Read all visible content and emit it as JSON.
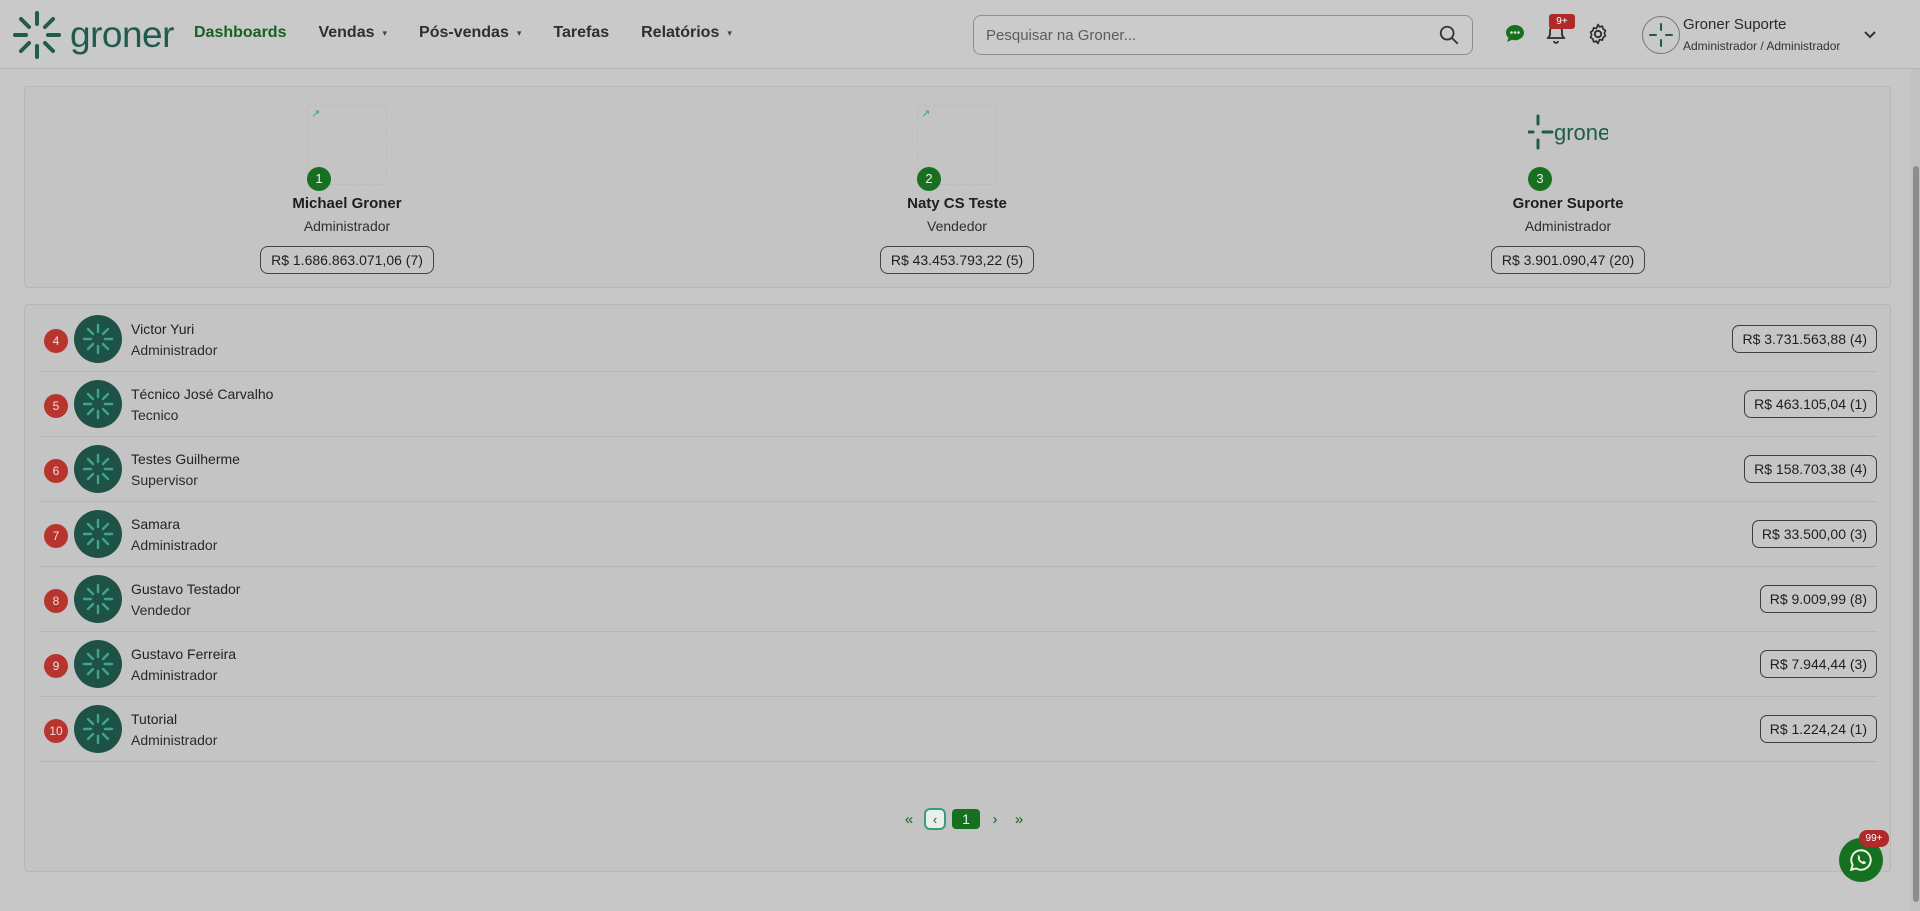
{
  "header": {
    "logo_text": "groner",
    "nav": [
      {
        "label": "Dashboards",
        "active": true,
        "has_caret": false
      },
      {
        "label": "Vendas",
        "active": false,
        "has_caret": true
      },
      {
        "label": "Pós-vendas",
        "active": false,
        "has_caret": true
      },
      {
        "label": "Tarefas",
        "active": false,
        "has_caret": false
      },
      {
        "label": "Relatórios",
        "active": false,
        "has_caret": true
      }
    ],
    "search_placeholder": "Pesquisar na Groner...",
    "notifications_badge": "9+",
    "user": {
      "name": "Groner Suporte",
      "role": "Administrador / Administrador"
    }
  },
  "podium": [
    {
      "rank": "1",
      "name": "Michael Groner",
      "role": "Administrador",
      "value": "R$ 1.686.863.071,06 (7)",
      "image": "broken"
    },
    {
      "rank": "2",
      "name": "Naty CS Teste",
      "role": "Vendedor",
      "value": "R$ 43.453.793,22 (5)",
      "image": "broken"
    },
    {
      "rank": "3",
      "name": "Groner Suporte",
      "role": "Administrador",
      "value": "R$ 3.901.090,47 (20)",
      "image": "groner-logo"
    }
  ],
  "ranking": [
    {
      "rank": "4",
      "name": "Victor Yuri",
      "role": "Administrador",
      "value": "R$ 3.731.563,88 (4)"
    },
    {
      "rank": "5",
      "name": "Técnico José Carvalho",
      "role": "Tecnico",
      "value": "R$ 463.105,04 (1)"
    },
    {
      "rank": "6",
      "name": "Testes Guilherme",
      "role": "Supervisor",
      "value": "R$ 158.703,38 (4)"
    },
    {
      "rank": "7",
      "name": "Samara",
      "role": "Administrador",
      "value": "R$ 33.500,00 (3)"
    },
    {
      "rank": "8",
      "name": "Gustavo Testador",
      "role": "Vendedor",
      "value": "R$ 9.009,99 (8)"
    },
    {
      "rank": "9",
      "name": "Gustavo Ferreira",
      "role": "Administrador",
      "value": "R$ 7.944,44 (3)"
    },
    {
      "rank": "10",
      "name": "Tutorial",
      "role": "Administrador",
      "value": "R$ 1.224,24 (1)"
    }
  ],
  "pagination": {
    "first": "«",
    "prev": "‹",
    "current": "1",
    "next": "›",
    "last": "»"
  },
  "whatsapp": {
    "badge": "99+"
  },
  "colors": {
    "brand_green": "#17701f",
    "brand_teal": "#1f5c4d",
    "rank_red": "#b8352f"
  }
}
